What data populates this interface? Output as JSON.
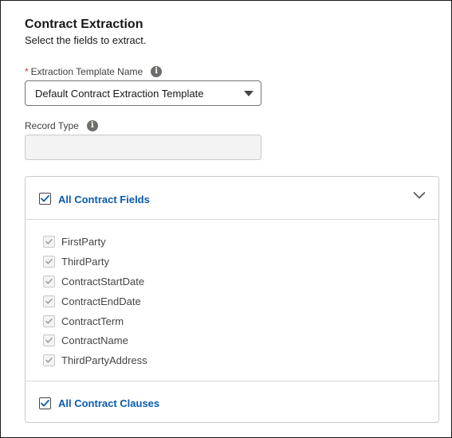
{
  "header": {
    "title": "Contract Extraction",
    "subtitle": "Select the fields to extract."
  },
  "template_field": {
    "required_marker": "*",
    "label": "Extraction Template Name",
    "value": "Default Contract Extraction Template"
  },
  "record_type": {
    "label": "Record Type",
    "value": ""
  },
  "fields_section": {
    "label": "All Contract Fields",
    "checked": true,
    "fields": [
      {
        "label": "FirstParty",
        "checked": true
      },
      {
        "label": "ThirdParty",
        "checked": true
      },
      {
        "label": "ContractStartDate",
        "checked": true
      },
      {
        "label": "ContractEndDate",
        "checked": true
      },
      {
        "label": "ContractTerm",
        "checked": true
      },
      {
        "label": "ContractName",
        "checked": true
      },
      {
        "label": "ThirdPartyAddress",
        "checked": true
      }
    ]
  },
  "clauses_section": {
    "label": "All Contract Clauses",
    "checked": true
  },
  "colors": {
    "accent": "#0b5cab",
    "required": "#c23934",
    "check_active": "#0b5cab",
    "check_disabled": "#939393"
  },
  "icons": {
    "info": "info-icon",
    "caret": "caret-down-icon",
    "chevron": "chevron-down-icon",
    "check": "checkmark-icon"
  }
}
